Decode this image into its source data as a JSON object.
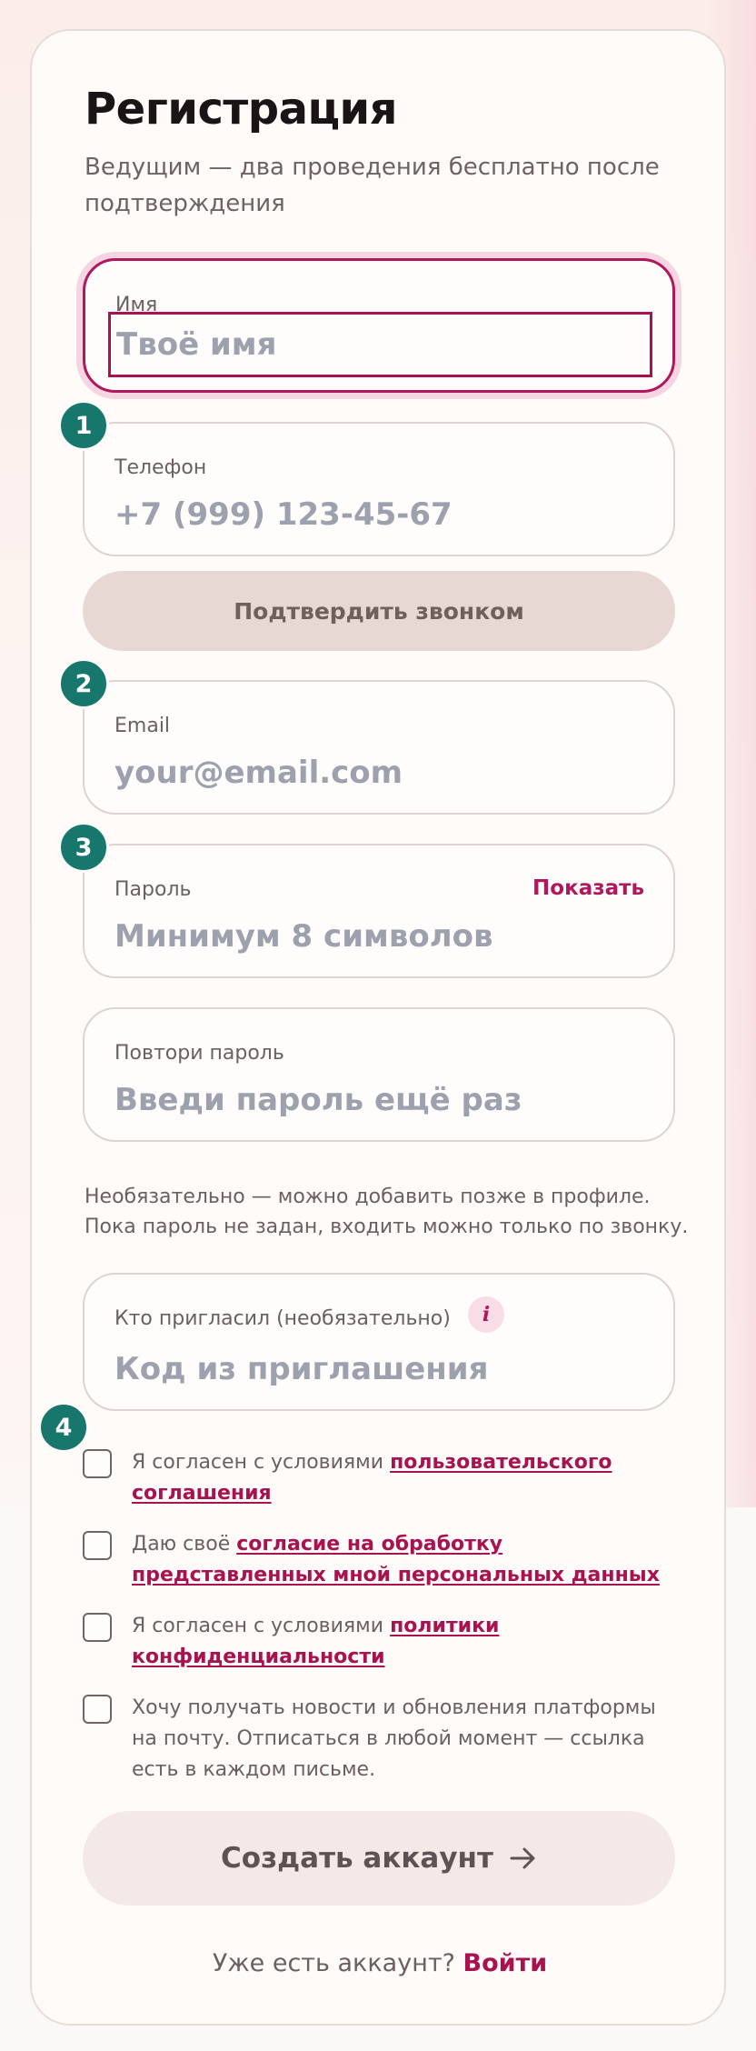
{
  "header": {
    "title": "Регистрация",
    "subtitle": "Ведущим — два проведения бесплатно после подтверждения"
  },
  "fields": {
    "name": {
      "label": "Имя",
      "placeholder": "Твоё имя"
    },
    "phone": {
      "label": "Телефон",
      "placeholder": "+7 (999) 123-45-67"
    },
    "email": {
      "label": "Email",
      "placeholder": "your@email.com"
    },
    "password": {
      "label": "Пароль",
      "placeholder": "Минимум 8 символов",
      "show_label": "Показать"
    },
    "password_repeat": {
      "label": "Повтори пароль",
      "placeholder": "Введи пароль ещё раз"
    },
    "invite": {
      "label": "Кто пригласил (необязательно)",
      "placeholder": "Код из приглашения",
      "info_glyph": "i"
    }
  },
  "confirm_call_button": "Подтвердить звонком",
  "password_hint": "Необязательно — можно добавить позже в профиле. Пока пароль не задан, входить можно только по звонку.",
  "steps": [
    "1",
    "2",
    "3",
    "4"
  ],
  "consents": [
    {
      "prefix": "Я согласен с условиями ",
      "link": "пользовательского соглашения"
    },
    {
      "prefix": "Даю своё ",
      "link": "согласие на обработку представленных мной персональных данных"
    },
    {
      "prefix": "Я согласен с условиями ",
      "link": "политики конфиденциальности"
    },
    {
      "prefix": "Хочу получать новости и обновления платформы на почту. Отписаться в любой момент — ссылка есть в каждом письме.",
      "link": ""
    }
  ],
  "create_button": "Создать аккаунт",
  "login": {
    "prompt": "Уже есть аккаунт? ",
    "link": "Войти"
  },
  "colors": {
    "accent": "#b0185c",
    "step_badge": "#17776d",
    "confirm_button_bg": "#e7d8d4",
    "create_button_bg": "#f4e9e6"
  },
  "icons": {
    "create_button": "arrow-right-icon",
    "invite_info": "info-icon"
  }
}
